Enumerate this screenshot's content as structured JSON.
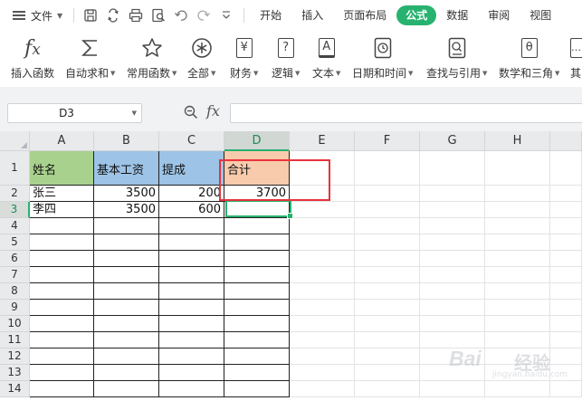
{
  "menubar": {
    "file_label": "文件",
    "tabs": [
      {
        "label": "开始",
        "active": false
      },
      {
        "label": "插入",
        "active": false
      },
      {
        "label": "页面布局",
        "active": false
      },
      {
        "label": "公式",
        "active": true
      },
      {
        "label": "数据",
        "active": false
      },
      {
        "label": "审阅",
        "active": false
      },
      {
        "label": "视图",
        "active": false
      }
    ],
    "quick_access_icons": [
      "save-icon",
      "cloud-sync-icon",
      "print-icon",
      "print-preview-icon",
      "undo-icon",
      "redo-icon",
      "customize-chevron-icon"
    ]
  },
  "ribbon": {
    "buttons": [
      {
        "label": "插入函数",
        "icon": "fx-icon",
        "has_dropdown": false
      },
      {
        "label": "自动求和",
        "icon": "sigma-icon",
        "has_dropdown": true
      },
      {
        "label": "常用函数",
        "icon": "star-icon",
        "has_dropdown": true
      },
      {
        "label": "全部",
        "icon": "asterisk-circle-icon",
        "has_dropdown": true
      },
      {
        "label": "财务",
        "icon": "yen-icon",
        "glyph": "¥",
        "has_dropdown": true
      },
      {
        "label": "逻辑",
        "icon": "question-icon",
        "glyph": "?",
        "has_dropdown": true
      },
      {
        "label": "文本",
        "icon": "text-a-icon",
        "glyph": "A",
        "has_dropdown": true
      },
      {
        "label": "日期和时间",
        "icon": "clock-icon",
        "has_dropdown": true
      },
      {
        "label": "查找与引用",
        "icon": "search-doc-icon",
        "has_dropdown": true
      },
      {
        "label": "数学和三角",
        "icon": "theta-icon",
        "glyph": "θ",
        "has_dropdown": true
      },
      {
        "label": "其",
        "icon": "more-icon",
        "glyph": "…",
        "has_dropdown": false
      }
    ]
  },
  "formula_bar": {
    "name_box": "D3",
    "fx_label": "fx",
    "formula": ""
  },
  "sheet": {
    "columns": [
      "A",
      "B",
      "C",
      "D",
      "E",
      "F",
      "G",
      "H"
    ],
    "selected_column": "D",
    "rows": [
      "1",
      "2",
      "3",
      "4",
      "5",
      "6",
      "7",
      "8",
      "9",
      "10",
      "11",
      "12",
      "13",
      "14"
    ],
    "selected_row": "3",
    "header_colors": {
      "A1": "#a9d18e",
      "B1": "#9dc3e6",
      "C1": "#9dc3e6",
      "D1": "#f8cbad"
    },
    "selection_color": "#27b26f",
    "highlight_box_color": "#e8333b",
    "cells": {
      "A1": "姓名",
      "B1": "基本工资",
      "C1": "提成",
      "D1": "合计",
      "A2": "张三",
      "B2": "3500",
      "C2": "200",
      "D2": "3700",
      "A3": "李四",
      "B3": "3500",
      "C3": "600",
      "D3": ""
    }
  },
  "watermark": {
    "brand": "Bai",
    "suffix": "经验",
    "url": "jingyan.baidu.com"
  }
}
